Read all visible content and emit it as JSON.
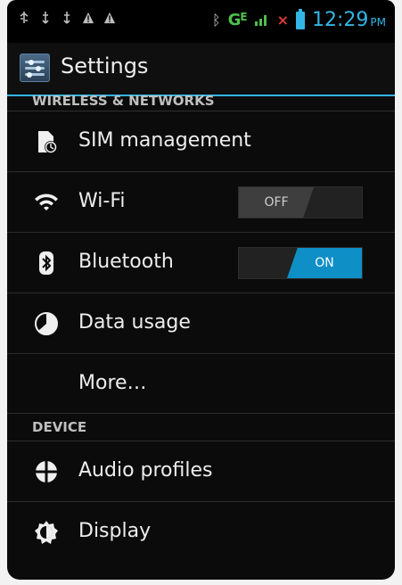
{
  "status_bar": {
    "left_icons": [
      "usb-icon",
      "usb-icon",
      "usb-icon",
      "warning-icon",
      "warning-icon"
    ],
    "network": "G",
    "network_badge": "E",
    "time": "12:29",
    "ampm": "PM",
    "colors": {
      "accent": "#33b5e5",
      "network": "#4ec04e",
      "no_call": "#e53935"
    }
  },
  "action_bar": {
    "title": "Settings"
  },
  "sections": {
    "wireless": "WIRELESS & NETWORKS",
    "device": "DEVICE"
  },
  "items": {
    "sim": {
      "label": "SIM management",
      "icon": "sim-icon"
    },
    "wifi": {
      "label": "Wi-Fi",
      "icon": "wifi-icon",
      "toggle": "OFF"
    },
    "bluetooth": {
      "label": "Bluetooth",
      "icon": "bluetooth-icon",
      "toggle": "ON"
    },
    "data": {
      "label": "Data usage",
      "icon": "data-usage-icon"
    },
    "more": {
      "label": "More…"
    },
    "audio": {
      "label": "Audio profiles",
      "icon": "audio-profiles-icon"
    },
    "display": {
      "label": "Display",
      "icon": "display-icon"
    }
  }
}
